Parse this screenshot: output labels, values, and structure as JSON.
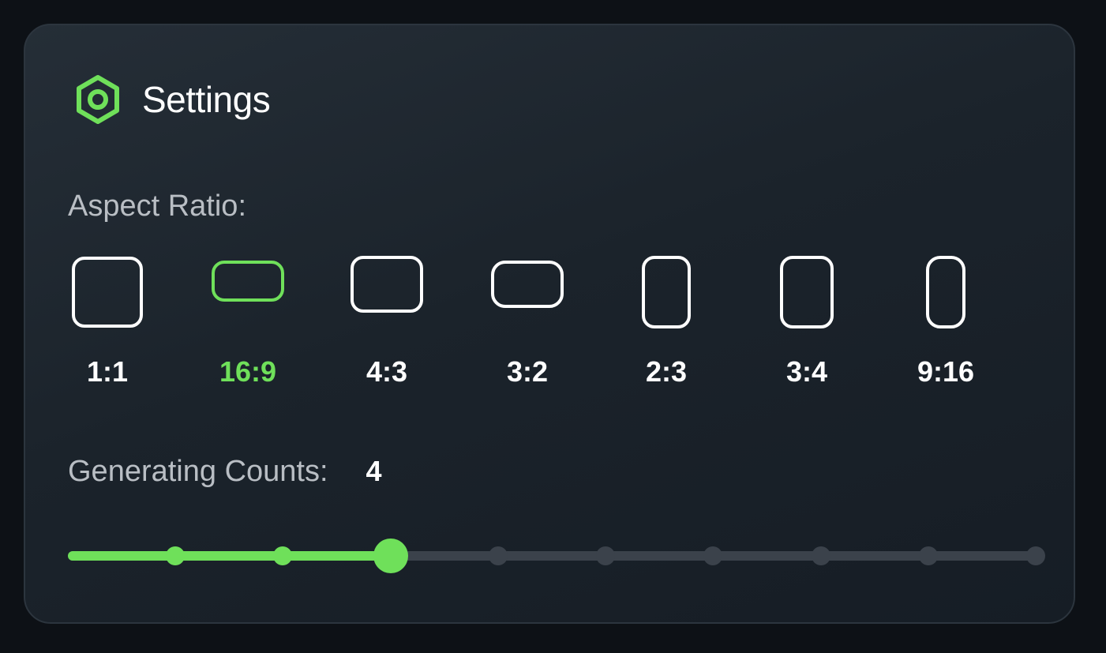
{
  "panel": {
    "title": "Settings",
    "icon": "settings-hexagon-icon",
    "accent_color": "#6fe05a"
  },
  "aspect_ratio": {
    "label": "Aspect Ratio:",
    "selected": "16:9",
    "options": [
      {
        "label": "1:1",
        "selected": false
      },
      {
        "label": "16:9",
        "selected": true
      },
      {
        "label": "4:3",
        "selected": false
      },
      {
        "label": "3:2",
        "selected": false
      },
      {
        "label": "2:3",
        "selected": false
      },
      {
        "label": "3:4",
        "selected": false
      },
      {
        "label": "9:16",
        "selected": false
      }
    ]
  },
  "generating_counts": {
    "label": "Generating Counts:",
    "value": "4",
    "slider": {
      "min": 1,
      "max": 10,
      "value": 4,
      "fill_color": "#6fe05a",
      "track_color": "#3b424b"
    }
  }
}
